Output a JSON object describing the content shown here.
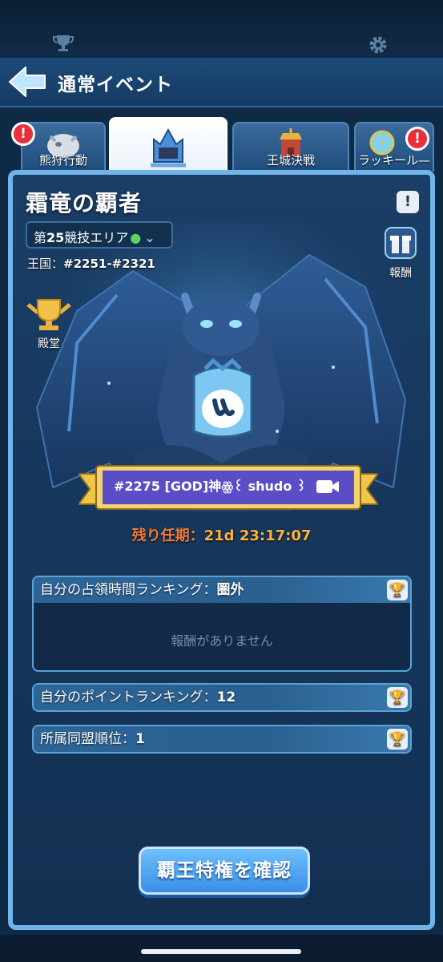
{
  "top_icons": {
    "left": "trophy-icon",
    "right": "gear-icon"
  },
  "header": {
    "title": "通常イベント",
    "back_icon": "back-arrow-icon"
  },
  "tabs": [
    {
      "label": "熊狩行動",
      "badge": "!",
      "active": false
    },
    {
      "label": "",
      "badge": "",
      "active": true
    },
    {
      "label": "王城決戦",
      "badge": "",
      "active": false
    },
    {
      "label": "ラッキール—",
      "badge": "!",
      "active": false
    }
  ],
  "event": {
    "title": "霜竜の覇者",
    "info": "!",
    "area_label_prefix": "第",
    "area_number": "25",
    "area_label_suffix": "競技エリア",
    "kingdom_label": "王国：",
    "kingdom_range": "#2251-#2321",
    "reward_label": "報酬",
    "hall_label": "殿堂",
    "banner_text": "#2275 [GOD]神ꙮ꒰ shudo ꒱ꙮ神",
    "remaining_label": "残り任期：",
    "remaining_time": "21d 23:17:07"
  },
  "rankings": [
    {
      "label": "自分の占領時間ランキング：",
      "value": "圏外",
      "empty_text": "報酬がありません"
    },
    {
      "label": "自分のポイントランキング：",
      "value": "12"
    },
    {
      "label": "所属同盟順位：",
      "value": "1"
    }
  ],
  "confirm_button": "覇王特権を確認",
  "colors": {
    "panel_border": "#6fb4ea",
    "timer": "#ffb13a",
    "remaining": "#f07a3a",
    "button": "#3b8ee6"
  }
}
